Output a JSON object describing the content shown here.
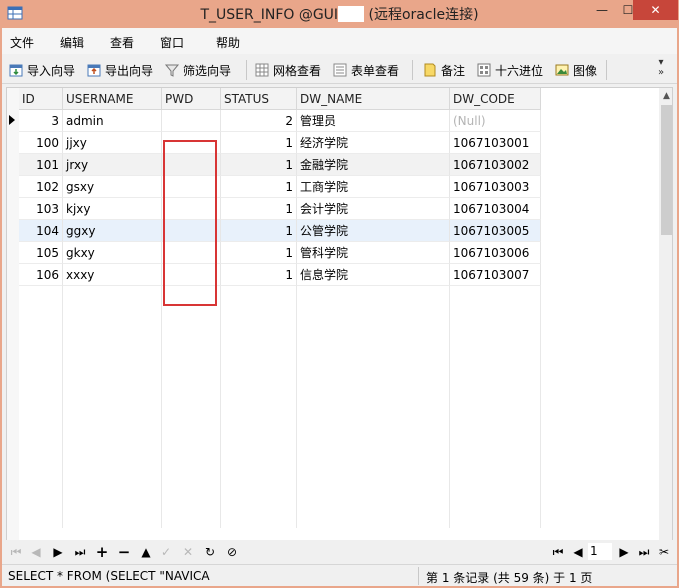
{
  "window": {
    "title_prefix": "T_USER_INFO @GUI",
    "title_suffix": " (远程oracle连接)",
    "min_glyph": "—",
    "max_glyph": "☐",
    "close_glyph": "✕"
  },
  "menu": [
    {
      "label": "文件"
    },
    {
      "label": "编辑"
    },
    {
      "label": "查看"
    },
    {
      "label": "窗口"
    },
    {
      "label": "帮助"
    }
  ],
  "toolbar": {
    "import": "导入向导",
    "export": "导出向导",
    "filter": "筛选向导",
    "grid_view": "网格查看",
    "form_view": "表单查看",
    "memo": "备注",
    "hex": "十六进位",
    "image": "图像",
    "more": "»"
  },
  "table": {
    "columns": [
      "ID",
      "USERNAME",
      "PWD",
      "STATUS",
      "DW_NAME",
      "DW_CODE"
    ],
    "rows": [
      {
        "id": "3",
        "username": "admin",
        "pwd": "",
        "status": "2",
        "dw_name": "管理员",
        "dw_code": "(Null)"
      },
      {
        "id": "100",
        "username": "jjxy",
        "pwd": "",
        "status": "1",
        "dw_name": "经济学院",
        "dw_code": "1067103001"
      },
      {
        "id": "101",
        "username": "jrxy",
        "pwd": "",
        "status": "1",
        "dw_name": "金融学院",
        "dw_code": "1067103002"
      },
      {
        "id": "102",
        "username": "gsxy",
        "pwd": "",
        "status": "1",
        "dw_name": "工商学院",
        "dw_code": "1067103003"
      },
      {
        "id": "103",
        "username": "kjxy",
        "pwd": "",
        "status": "1",
        "dw_name": "会计学院",
        "dw_code": "1067103004"
      },
      {
        "id": "104",
        "username": "ggxy",
        "pwd": "",
        "status": "1",
        "dw_name": "公管学院",
        "dw_code": "1067103005"
      },
      {
        "id": "105",
        "username": "gkxy",
        "pwd": "",
        "status": "1",
        "dw_name": "管科学院",
        "dw_code": "1067103006"
      },
      {
        "id": "106",
        "username": "xxxy",
        "pwd": "",
        "status": "1",
        "dw_name": "信息学院",
        "dw_code": "1067103007"
      }
    ]
  },
  "navigator": {
    "page": "1"
  },
  "status": {
    "sql": "SELECT * FROM (SELECT \"NAVICA",
    "record_info": "第 1 条记录 (共 59 条) 于 1 页"
  },
  "colors": {
    "titlebar": "#e9a68a",
    "close": "#c7463a",
    "redact_border": "#d83535",
    "null_text": "#b4b4b4"
  }
}
